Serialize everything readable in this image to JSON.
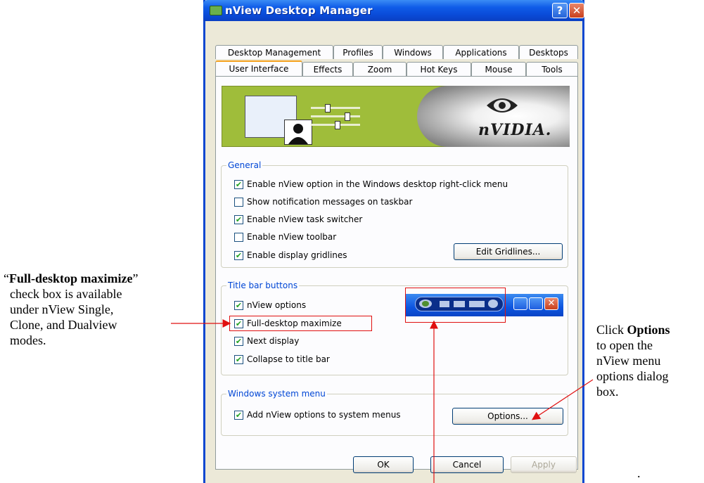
{
  "window": {
    "title": "nView Desktop Manager",
    "help_label": "?",
    "close_label": "✕"
  },
  "tabs": {
    "row1": [
      "Desktop Management",
      "Profiles",
      "Windows",
      "Applications",
      "Desktops"
    ],
    "row2": [
      "User Interface",
      "Effects",
      "Zoom",
      "Hot Keys",
      "Mouse",
      "Tools"
    ],
    "active": "User Interface"
  },
  "banner": {
    "logo_text": "nVIDIA."
  },
  "general": {
    "title": "General",
    "items": [
      {
        "label": "Enable nView option in the Windows desktop right-click menu",
        "checked": true
      },
      {
        "label": "Show notification messages on taskbar",
        "checked": false
      },
      {
        "label": "Enable nView task switcher",
        "checked": true
      },
      {
        "label": "Enable nView toolbar",
        "checked": false
      },
      {
        "label": "Enable display gridlines",
        "checked": true
      }
    ],
    "edit_gridlines_label": "Edit Gridlines..."
  },
  "title_bar_buttons": {
    "title": "Title bar buttons",
    "items": [
      {
        "label": "nView options",
        "checked": true
      },
      {
        "label": "Full-desktop maximize",
        "checked": true
      },
      {
        "label": "Next display",
        "checked": true
      },
      {
        "label": "Collapse to title bar",
        "checked": true
      }
    ]
  },
  "system_menu": {
    "title": "Windows system menu",
    "items": [
      {
        "label": "Add nView options to system menus",
        "checked": true
      }
    ],
    "options_label": "Options..."
  },
  "footer": {
    "ok_label": "OK",
    "cancel_label": "Cancel",
    "apply_label": "Apply"
  },
  "annotations": {
    "left_quote_open": "“",
    "left_bold": "Full-desktop maximize",
    "left_quote_close": "”",
    "left_lines": [
      "check box is available",
      "under nView Single,",
      "Clone, and Dualview",
      "modes."
    ],
    "right_line1_prefix": "Click ",
    "right_line1_bold": "Options",
    "right_lines": [
      "to open the",
      "nView menu",
      "options dialog",
      "box."
    ],
    "trailing_dot": "."
  },
  "colors": {
    "xp_blue": "#0a4bd8",
    "check_green": "#21a121",
    "annotation_red": "#e01010",
    "banner_green": "#9fbd3a"
  }
}
